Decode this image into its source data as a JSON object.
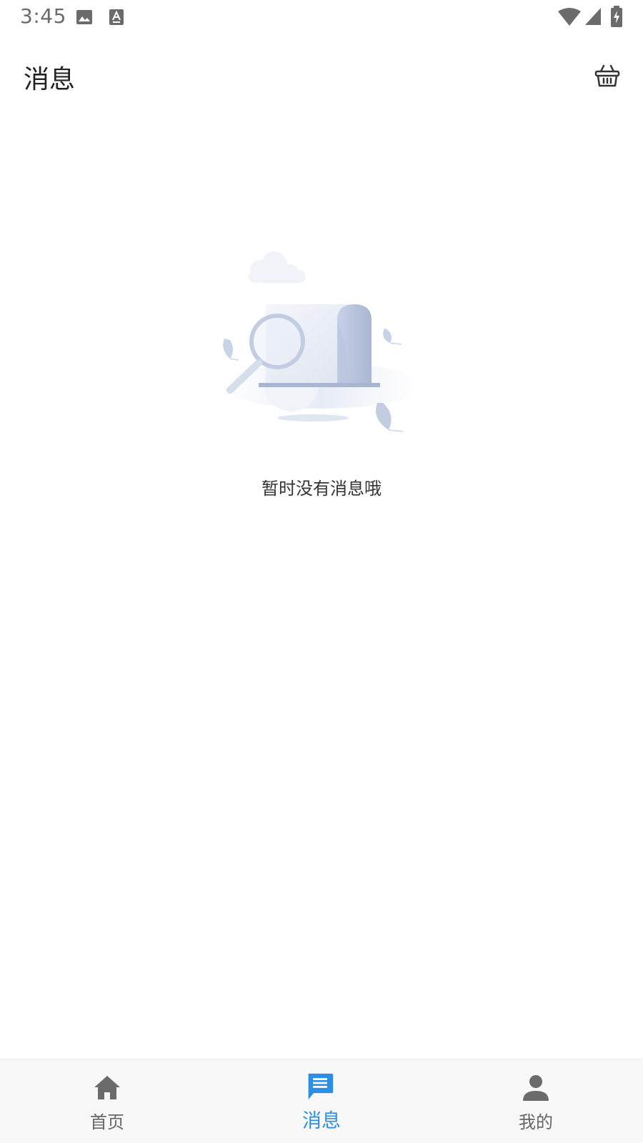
{
  "status_bar": {
    "time": "3:45",
    "icons": [
      "image-icon",
      "keyboard-a-icon",
      "wifi-icon",
      "signal-icon",
      "battery-charging-icon"
    ]
  },
  "header": {
    "title": "消息",
    "action_icon": "basket-icon"
  },
  "empty_state": {
    "illustration": "empty-messages-illustration",
    "message": "暂时没有消息哦"
  },
  "bottom_nav": {
    "items": [
      {
        "label": "首页",
        "icon": "home-icon",
        "active": false
      },
      {
        "label": "消息",
        "icon": "message-icon",
        "active": true
      },
      {
        "label": "我的",
        "icon": "person-icon",
        "active": false
      }
    ],
    "active_color": "#2b8fe6",
    "inactive_color": "#666666"
  }
}
